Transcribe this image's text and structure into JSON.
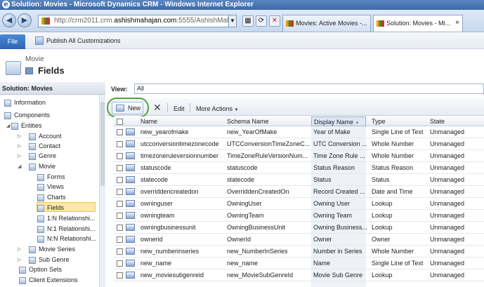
{
  "window": {
    "title": "Solution: Movies - Microsoft Dynamics CRM - Windows Internet Explorer"
  },
  "browser": {
    "url_prefix": "http://crm2011.crm.",
    "url_host": "ashishmahajan.com",
    "url_suffix": ":5555/AshishMah",
    "tabs": [
      {
        "label": "Movies: Active Movies -..."
      },
      {
        "label": "Solution: Movies - Mi...",
        "close": "×"
      }
    ]
  },
  "ribbon": {
    "file_label": "File",
    "publish_label": "Publish All Customizations"
  },
  "header": {
    "entity": "Movie",
    "title": "Fields"
  },
  "leftnav": {
    "solution_title": "Solution: Movies",
    "items": [
      {
        "label": "Information"
      },
      {
        "label": "Components"
      },
      {
        "label": "Entities"
      },
      {
        "label": "Account"
      },
      {
        "label": "Contact"
      },
      {
        "label": "Genre"
      },
      {
        "label": "Movie"
      },
      {
        "label": "Forms"
      },
      {
        "label": "Views"
      },
      {
        "label": "Charts"
      },
      {
        "label": "Fields"
      },
      {
        "label": "1:N Relationshi..."
      },
      {
        "label": "N:1 Relationshi..."
      },
      {
        "label": "N:N Relationshi..."
      },
      {
        "label": "Movie Series"
      },
      {
        "label": "Sub Genre"
      },
      {
        "label": "Option Sets"
      },
      {
        "label": "Client Extensions"
      }
    ]
  },
  "view": {
    "label": "View:",
    "value": "All"
  },
  "toolbar": {
    "new_label": "New",
    "edit_label": "Edit",
    "more_actions_label": "More Actions"
  },
  "grid": {
    "columns": [
      "Name",
      "Schema Name",
      "Display Name",
      "Type",
      "State"
    ],
    "rows": [
      [
        "new_yearofmake",
        "new_YearOfMake",
        "Year of Make",
        "Single Line of Text",
        "Unmanaged"
      ],
      [
        "utcconversiontimezonecode",
        "UTCConversionTimeZoneC...",
        "UTC Conversion ...",
        "Whole Number",
        "Unmanaged"
      ],
      [
        "timezoneruleversionnumber",
        "TimeZoneRuleVersionNum...",
        "Time Zone Rule ...",
        "Whole Number",
        "Unmanaged"
      ],
      [
        "statuscode",
        "statuscode",
        "Status Reason",
        "Status Reason",
        "Unmanaged"
      ],
      [
        "statecode",
        "statecode",
        "Status",
        "Status",
        "Unmanaged"
      ],
      [
        "overriddencreatedon",
        "OverriddenCreatedOn",
        "Record Created ...",
        "Date and Time",
        "Unmanaged"
      ],
      [
        "owninguser",
        "OwningUser",
        "Owning User",
        "Lookup",
        "Unmanaged"
      ],
      [
        "owningteam",
        "OwningTeam",
        "Owning Team",
        "Lookup",
        "Unmanaged"
      ],
      [
        "owningbusinessunit",
        "OwningBusinessUnit",
        "Owning Business...",
        "Lookup",
        "Unmanaged"
      ],
      [
        "ownerid",
        "OwnerId",
        "Owner",
        "Owner",
        "Unmanaged"
      ],
      [
        "new_numberinseries",
        "new_NumberInSeries",
        "Number in Series",
        "Whole Number",
        "Unmanaged"
      ],
      [
        "new_name",
        "new_name",
        "Name",
        "Single Line of Text",
        "Unmanaged"
      ],
      [
        "new_moviesubgenreid",
        "new_MovieSubGenreId",
        "Movie Sub Genre",
        "Lookup",
        "Unmanaged"
      ]
    ]
  }
}
